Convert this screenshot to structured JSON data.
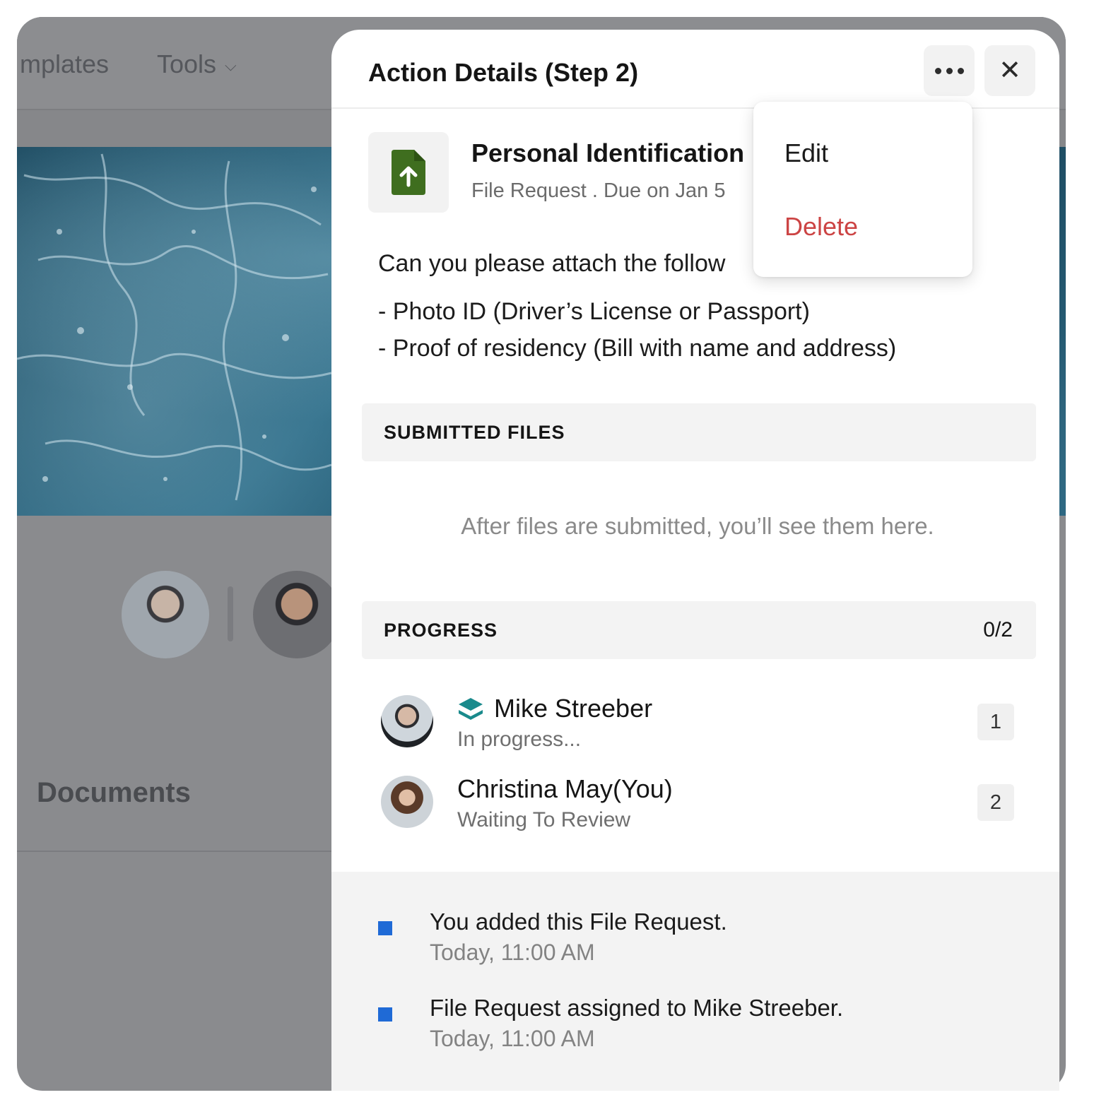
{
  "background": {
    "nav": {
      "templates_label": "mplates",
      "tools_label": "Tools"
    },
    "documents_heading": "Documents"
  },
  "panel": {
    "title": "Action Details (Step 2)",
    "request": {
      "title": "Personal Identification",
      "type": "File Request",
      "due": "Due on Jan 5",
      "icon": "file-upload-icon",
      "icon_color": "#3f6e1f"
    },
    "message": {
      "intro": "Can you please attach the follow",
      "items": [
        "- Photo ID (Driver’s License or Passport)",
        "- Proof of residency (Bill with name and address)"
      ]
    },
    "submitted_files": {
      "heading": "SUBMITTED FILES",
      "empty_text": "After files are submitted, you’ll see them here."
    },
    "progress": {
      "heading": "PROGRESS",
      "count": "0/2",
      "people": [
        {
          "name": "Mike Streeber",
          "status": "In progress...",
          "step": "1",
          "icon": "stack-layers-icon",
          "icon_color": "#1a8a8c"
        },
        {
          "name": "Christina May(You)",
          "status": "Waiting To Review",
          "step": "2"
        }
      ]
    },
    "activity": [
      {
        "text": "You added this File Request.",
        "time": "Today, 11:00 AM"
      },
      {
        "text": "File Request assigned to Mike Streeber.",
        "time": "Today, 11:00 AM"
      }
    ],
    "accent_color": "#1f6ad6"
  },
  "menu": {
    "items": [
      {
        "label": "Edit",
        "color": "#1a1a1a"
      },
      {
        "label": "Delete",
        "color": "#cc4444"
      }
    ]
  }
}
